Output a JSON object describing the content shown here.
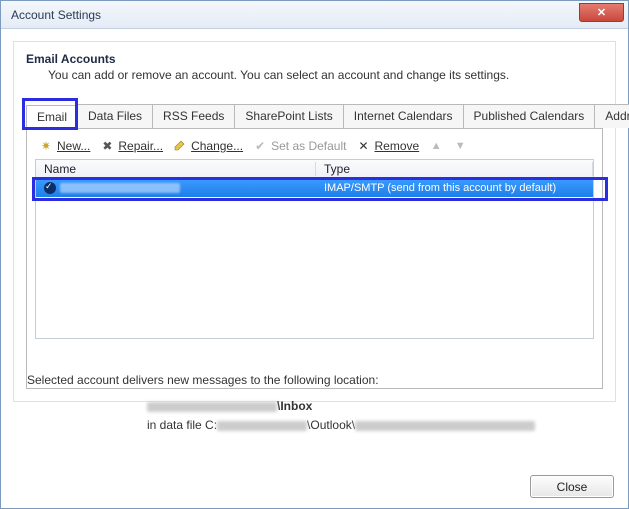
{
  "window": {
    "title": "Account Settings"
  },
  "panel": {
    "heading": "Email Accounts",
    "description": "You can add or remove an account. You can select an account and change its settings."
  },
  "tabs": [
    {
      "label": "Email",
      "selected": true
    },
    {
      "label": "Data Files",
      "selected": false
    },
    {
      "label": "RSS Feeds",
      "selected": false
    },
    {
      "label": "SharePoint Lists",
      "selected": false
    },
    {
      "label": "Internet Calendars",
      "selected": false
    },
    {
      "label": "Published Calendars",
      "selected": false
    },
    {
      "label": "Address Books",
      "selected": false
    }
  ],
  "toolbar": {
    "new_label": "New...",
    "repair_label": "Repair...",
    "change_label": "Change...",
    "setdefault_label": "Set as Default",
    "remove_label": "Remove"
  },
  "columns": {
    "name": "Name",
    "type": "Type"
  },
  "accounts": [
    {
      "name": "",
      "type": "IMAP/SMTP (send from this account by default)",
      "is_default": true,
      "selected": true
    }
  ],
  "location": {
    "intro": "Selected account delivers new messages to the following location:",
    "folder_suffix": "\\Inbox",
    "datafile_prefix": "in data file C:",
    "datafile_mid": "\\Outlook\\"
  },
  "buttons": {
    "close": "Close"
  }
}
